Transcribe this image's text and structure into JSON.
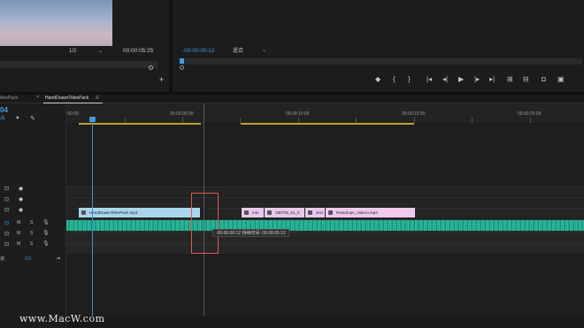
{
  "source_monitor": {
    "zoom": "1/2",
    "timecode": "00:00:05:25"
  },
  "program_monitor": {
    "timecode": "-00:00:00:12",
    "fit": "适合",
    "controls": [
      "marker-icon",
      "mark-in-icon",
      "mark-out-icon",
      "go-to-in-icon",
      "step-back-icon",
      "play-icon",
      "step-forward-icon",
      "go-to-out-icon",
      "lift-icon",
      "extract-icon",
      "export-frame-icon",
      "compare-icon"
    ]
  },
  "tabs": [
    {
      "label": "itlesPack",
      "active": false
    },
    {
      "label": "HandDrawnTitlesPack",
      "active": true
    }
  ],
  "timeline": {
    "timecode": "04",
    "ruler_labels": [
      ":00:00",
      "00:00:05:00",
      "00:00:10:00",
      "00:00:15:00",
      "00:00:20:00"
    ],
    "audio_value": "0.0",
    "audio_label": "道",
    "clips": [
      {
        "label": "HandDrawnTitlesPack.mp4",
        "color": "#a9d6ec"
      },
      {
        "label": "mix",
        "color": "#e8c8ea"
      },
      {
        "label": "180705_01_0",
        "color": "#e8c8ea"
      },
      {
        "label": "vect",
        "color": "#e8c8ea"
      },
      {
        "label": "Raindrops_Videvo.mp4",
        "color": "#f0c8ec"
      }
    ],
    "tooltip": "-00:00:00:12 持续时间: 00:00:05:12"
  },
  "watermark": "www.MacW.com",
  "colors": {
    "accent_blue": "#3f9be6",
    "audio_teal": "#2ec8a7",
    "work_area": "#b9a52e",
    "highlight_box": "#e05a4a"
  }
}
